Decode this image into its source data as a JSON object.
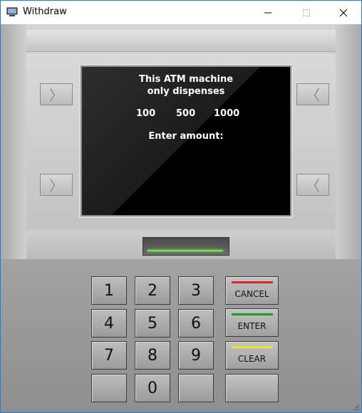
{
  "window": {
    "title": "Withdraw"
  },
  "screen": {
    "line1": "This ATM machine",
    "line2": "only dispenses",
    "amounts": [
      "100",
      "500",
      "1000"
    ],
    "prompt": "Enter amount:"
  },
  "keypad": {
    "digits": [
      "1",
      "2",
      "3",
      "4",
      "5",
      "6",
      "7",
      "8",
      "9",
      "",
      "0",
      ""
    ],
    "cancel_label": "CANCEL",
    "enter_label": "ENTER",
    "clear_label": "CLEAR"
  },
  "colors": {
    "cancel": "#d42a2a",
    "enter": "#1f9a2a",
    "clear": "#e6e62a",
    "card_led": "#6df04a"
  }
}
